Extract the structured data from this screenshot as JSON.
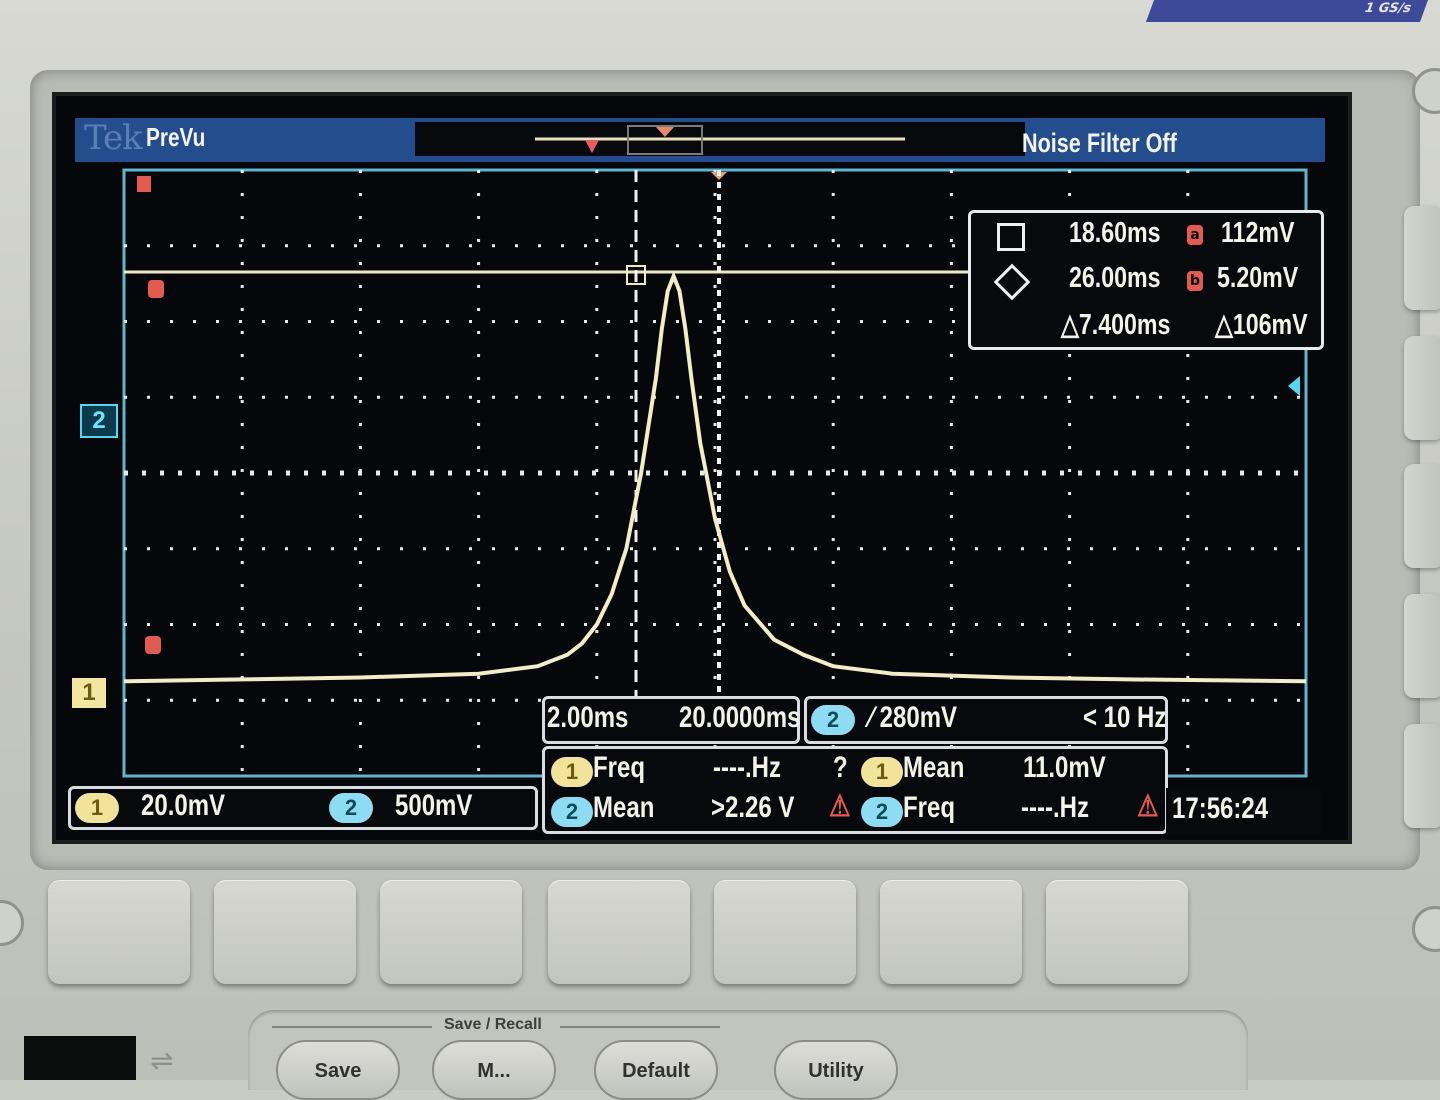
{
  "device": {
    "badge": "1 GS/s",
    "brand": "Tek",
    "mode": "PreVu",
    "noise_filter": "Noise Filter Off"
  },
  "channels": {
    "ch1_marker": "1",
    "ch2_marker": "2"
  },
  "cursors": {
    "cursor_a_time": "18.60ms",
    "cursor_a_volt": "112mV",
    "cursor_b_time": "26.00ms",
    "cursor_b_volt": "5.20mV",
    "delta_time": "△7.400ms",
    "delta_volt": "△106mV",
    "label_a": "a",
    "label_b": "b"
  },
  "vertical": {
    "ch1_scale": "20.0mV",
    "ch2_scale": "500mV",
    "ch1_label": "1",
    "ch2_label": "2"
  },
  "horizontal": {
    "time_div": "2.00ms",
    "position": "20.0000ms"
  },
  "trigger": {
    "source": "2",
    "slope_level": "⁄ 280mV",
    "frequency": "< 10 Hz"
  },
  "measurements": [
    {
      "channel": "1",
      "name": "Freq",
      "value": "----.Hz",
      "flag": "?"
    },
    {
      "channel": "1",
      "name": "Mean",
      "value": "11.0mV",
      "flag": ""
    },
    {
      "channel": "2",
      "name": "Mean",
      "value": ">2.26 V",
      "flag": "⚠"
    },
    {
      "channel": "2",
      "name": "Freq",
      "value": "----.Hz",
      "flag": "⚠"
    }
  ],
  "clock": "17:56:24",
  "front_panel": {
    "group_title": "Save / Recall",
    "buttons": [
      "Save",
      "M...",
      "Default",
      "Utility"
    ]
  },
  "waveform": {
    "type": "line",
    "series": [
      {
        "x": [
          0,
          4,
          8,
          12,
          14,
          15,
          15.5,
          16,
          16.5,
          17,
          17.5,
          18,
          18.2,
          18.4,
          18.6,
          18.8,
          19,
          19.2,
          19.5,
          20,
          20.5,
          21,
          22,
          23,
          24,
          26,
          30,
          34,
          40
        ],
        "values": [
          5,
          5.5,
          6,
          7,
          9,
          12,
          15,
          20,
          28,
          40,
          60,
          85,
          98,
          108,
          112,
          108,
          98,
          85,
          68,
          48,
          34,
          25,
          16,
          12,
          9,
          7,
          6,
          5.5,
          5
        ]
      }
    ],
    "xlim": [
      0,
      40
    ],
    "ylim": [
      -20,
      140
    ],
    "color": "#f2edc7"
  }
}
